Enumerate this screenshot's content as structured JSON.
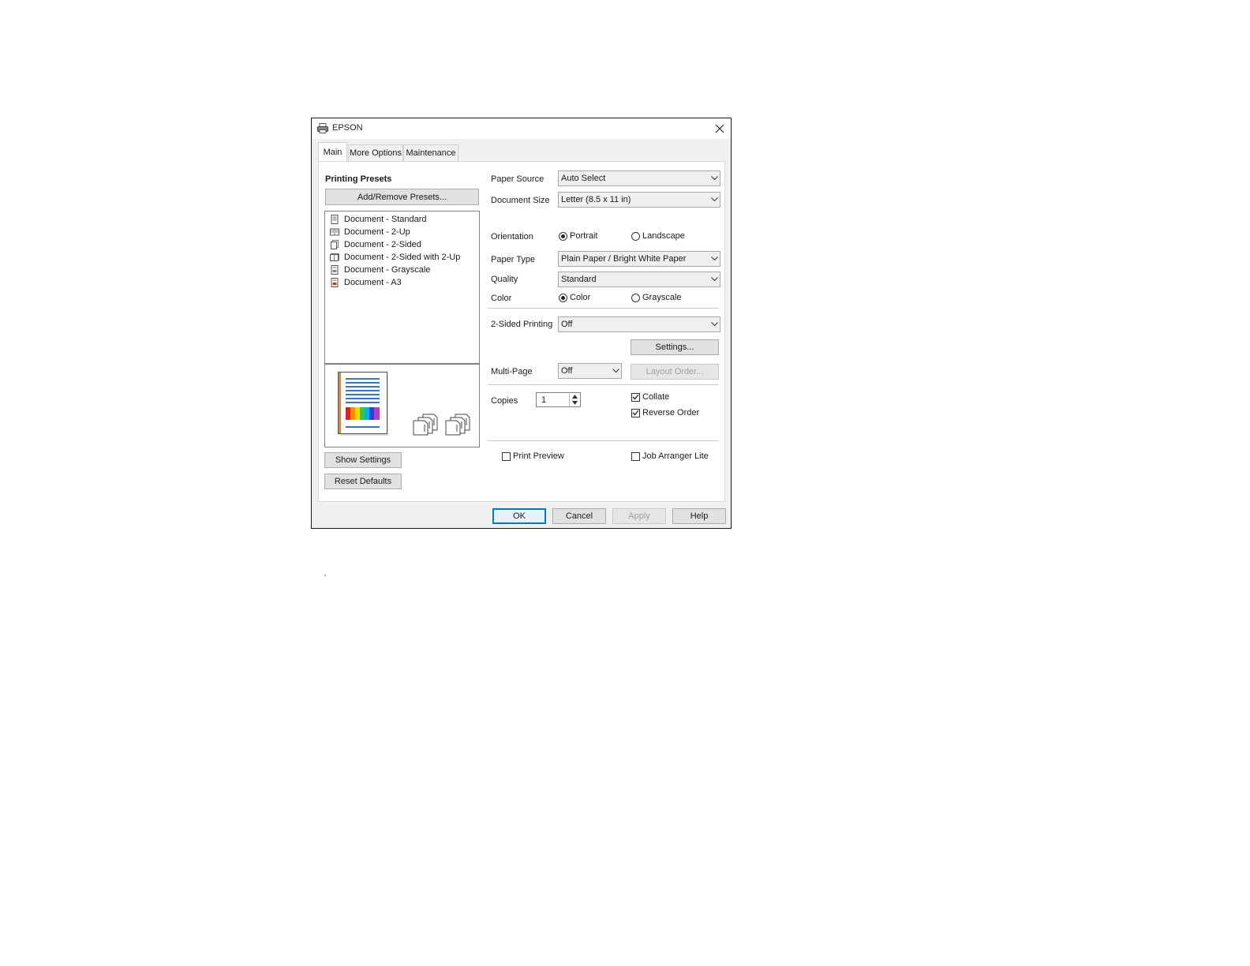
{
  "window": {
    "title": "EPSON",
    "icon": "printer-icon"
  },
  "tabs": [
    {
      "label": "Main",
      "active": true
    },
    {
      "label": "More Options",
      "active": false
    },
    {
      "label": "Maintenance",
      "active": false
    }
  ],
  "presets": {
    "heading": "Printing Presets",
    "add_remove_button": "Add/Remove Presets...",
    "items": [
      {
        "label": "Document - Standard",
        "icon": "document-standard-icon"
      },
      {
        "label": "Document - 2-Up",
        "icon": "document-2up-icon"
      },
      {
        "label": "Document - 2-Sided",
        "icon": "document-2sided-icon"
      },
      {
        "label": "Document - 2-Sided with 2-Up",
        "icon": "document-2sided-2up-icon"
      },
      {
        "label": "Document - Grayscale",
        "icon": "document-grayscale-icon"
      },
      {
        "label": "Document - A3",
        "icon": "document-a3-icon"
      }
    ]
  },
  "left_buttons": {
    "show_settings": "Show Settings",
    "reset_defaults": "Reset Defaults"
  },
  "settings": {
    "paper_source": {
      "label": "Paper Source",
      "value": "Auto Select"
    },
    "document_size": {
      "label": "Document Size",
      "value": "Letter (8.5 x 11 in)"
    },
    "orientation": {
      "label": "Orientation",
      "options": [
        "Portrait",
        "Landscape"
      ],
      "selected": "Portrait"
    },
    "paper_type": {
      "label": "Paper Type",
      "value": "Plain Paper / Bright White Paper"
    },
    "quality": {
      "label": "Quality",
      "value": "Standard"
    },
    "color": {
      "label": "Color",
      "options": [
        "Color",
        "Grayscale"
      ],
      "selected": "Color"
    },
    "two_sided": {
      "label": "2-Sided Printing",
      "value": "Off",
      "settings_button": "Settings..."
    },
    "multi_page": {
      "label": "Multi-Page",
      "value": "Off",
      "layout_order_button": "Layout Order..."
    },
    "copies": {
      "label": "Copies",
      "value": "1"
    },
    "collate": {
      "label": "Collate",
      "checked": true
    },
    "reverse_order": {
      "label": "Reverse Order",
      "checked": true
    },
    "print_preview": {
      "label": "Print Preview",
      "checked": false
    },
    "job_arranger": {
      "label": "Job Arranger Lite",
      "checked": false
    }
  },
  "footer": {
    "ok": "OK",
    "cancel": "Cancel",
    "apply": "Apply",
    "help": "Help"
  },
  "colors": {
    "accent": "#0078d7",
    "preview_page_border": "#e08a1e",
    "preview_lines": "#2a7ad4"
  }
}
